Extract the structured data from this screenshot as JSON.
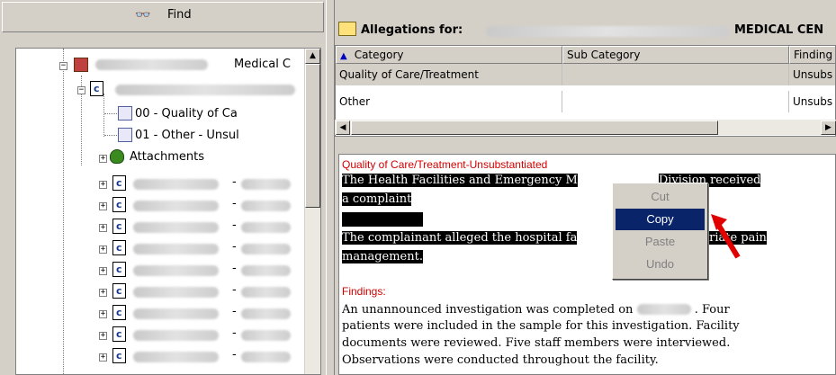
{
  "find": {
    "label": "Find"
  },
  "tree": {
    "root_label": "Medical C",
    "items": [
      {
        "label": "00 - Quality of Ca"
      },
      {
        "label": "01 - Other - Unsul"
      },
      {
        "label": "Attachments"
      }
    ],
    "dash": "-"
  },
  "header": {
    "allegations_label": "Allegations for:",
    "medical_center": "MEDICAL CEN"
  },
  "grid": {
    "columns": [
      "Category",
      "Sub Category",
      "Finding"
    ],
    "rows": [
      {
        "category": "Quality of Care/Treatment",
        "subcategory": "",
        "finding": "Unsubs"
      },
      {
        "category": "Other",
        "subcategory": "",
        "finding": "Unsubs"
      }
    ]
  },
  "document": {
    "heading1": "Quality of Care/Treatment-Unsubstantiated",
    "para1a": "The Health Facilities and Emergency M",
    "para1b": "Division received",
    "para1c": "a complaint",
    "para2a": "The complainant alleged the hospital fa",
    "para2b": "appropriate pain",
    "para2c": "management.",
    "heading2": "Findings:",
    "f1a": "An unannounced investigation was completed on",
    "f1b": ".  Four",
    "f2": "patients were included in the sample for this investigation. Facility",
    "f3": "documents were reviewed. Five staff members were interviewed.",
    "f4": "Observations were conducted throughout the facility."
  },
  "context_menu": {
    "items": [
      {
        "label": "Cut",
        "enabled": false
      },
      {
        "label": "Copy",
        "enabled": true,
        "highlighted": true
      },
      {
        "label": "Paste",
        "enabled": false
      },
      {
        "label": "Undo",
        "enabled": false
      }
    ]
  },
  "colors": {
    "selection": "#000000",
    "menu_highlight": "#0a246a",
    "heading_red": "#d40000",
    "arrow": "#e00000"
  }
}
